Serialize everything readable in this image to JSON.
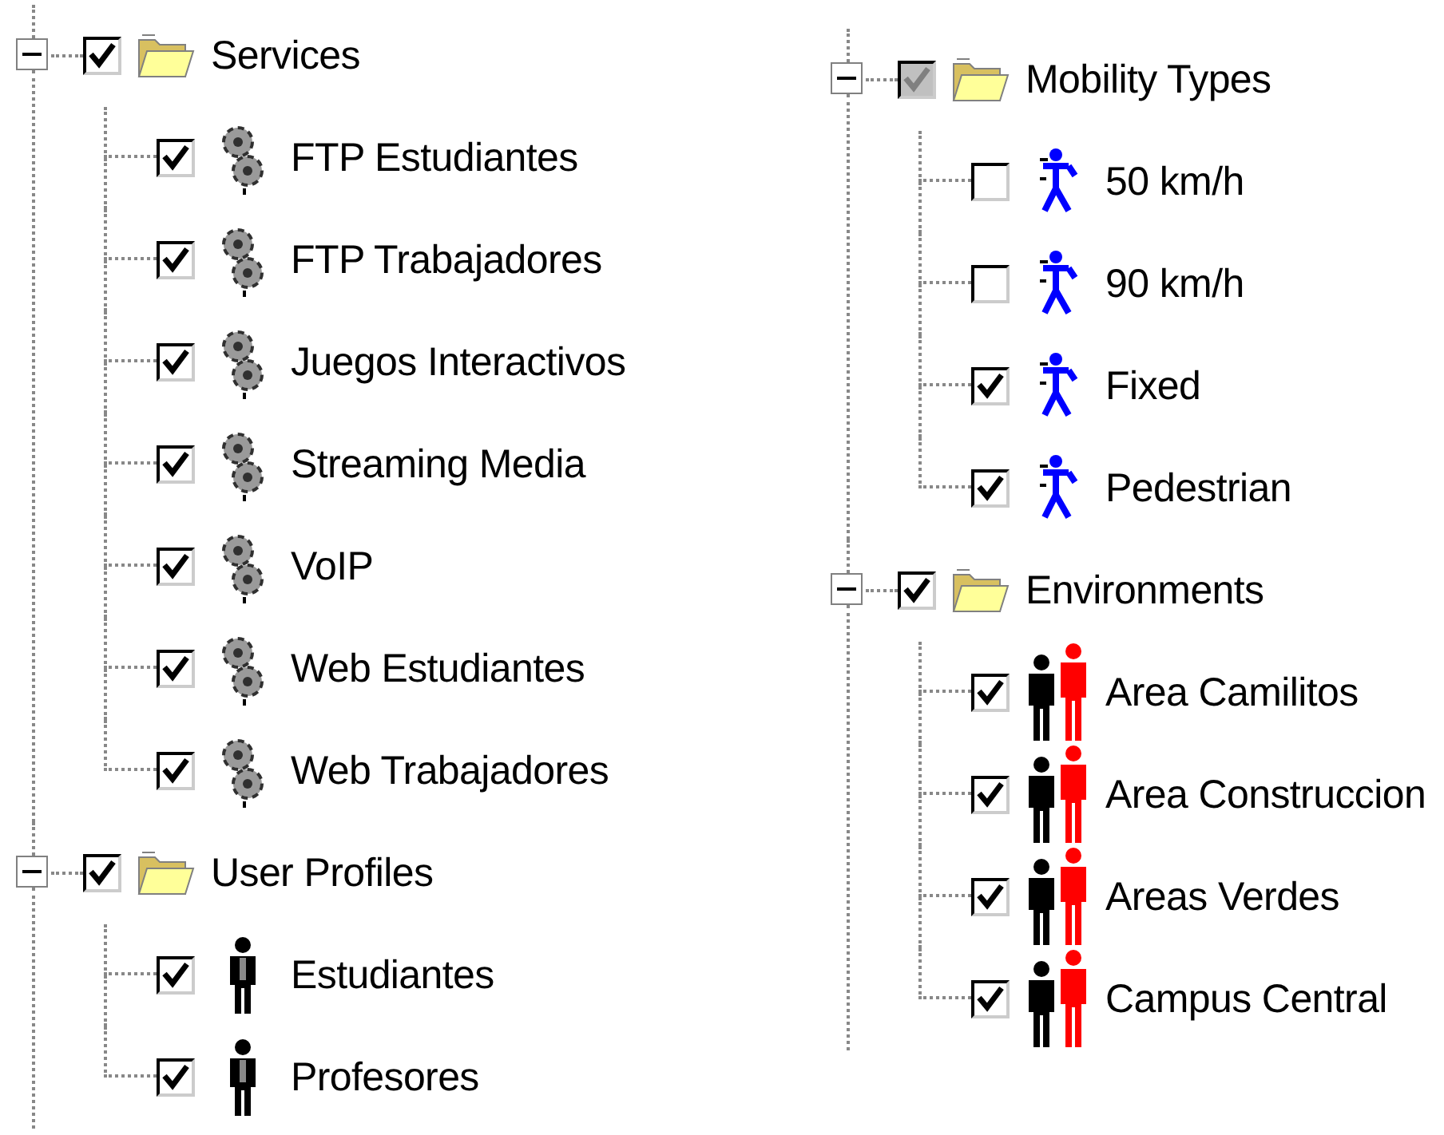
{
  "columns": [
    {
      "nodes": [
        {
          "label": "Services",
          "kind": "folder",
          "expanded": true,
          "checked": true,
          "partial": false,
          "children": [
            {
              "label": "FTP Estudiantes",
              "kind": "service",
              "checked": true
            },
            {
              "label": "FTP Trabajadores",
              "kind": "service",
              "checked": true
            },
            {
              "label": "Juegos Interactivos",
              "kind": "service",
              "checked": true
            },
            {
              "label": "Streaming Media",
              "kind": "service",
              "checked": true
            },
            {
              "label": "VoIP",
              "kind": "service",
              "checked": true
            },
            {
              "label": "Web Estudiantes",
              "kind": "service",
              "checked": true
            },
            {
              "label": "Web Trabajadores",
              "kind": "service",
              "checked": true
            }
          ]
        },
        {
          "label": "User Profiles",
          "kind": "folder",
          "expanded": true,
          "checked": true,
          "partial": false,
          "children": [
            {
              "label": "Estudiantes",
              "kind": "user",
              "checked": true
            },
            {
              "label": "Profesores",
              "kind": "user",
              "checked": true
            }
          ]
        }
      ]
    },
    {
      "nodes": [
        {
          "label": "Mobility Types",
          "kind": "folder",
          "expanded": true,
          "checked": true,
          "partial": true,
          "children": [
            {
              "label": "50 km/h",
              "kind": "mobility",
              "checked": false
            },
            {
              "label": "90 km/h",
              "kind": "mobility",
              "checked": false
            },
            {
              "label": "Fixed",
              "kind": "mobility",
              "checked": true
            },
            {
              "label": "Pedestrian",
              "kind": "mobility",
              "checked": true
            }
          ]
        },
        {
          "label": "Environments",
          "kind": "folder",
          "expanded": true,
          "checked": true,
          "partial": false,
          "children": [
            {
              "label": "Area Camilitos",
              "kind": "environment",
              "checked": true
            },
            {
              "label": "Area Construccion",
              "kind": "environment",
              "checked": true
            },
            {
              "label": "Areas Verdes",
              "kind": "environment",
              "checked": true
            },
            {
              "label": "Campus Central",
              "kind": "environment",
              "checked": true
            }
          ]
        }
      ]
    }
  ]
}
